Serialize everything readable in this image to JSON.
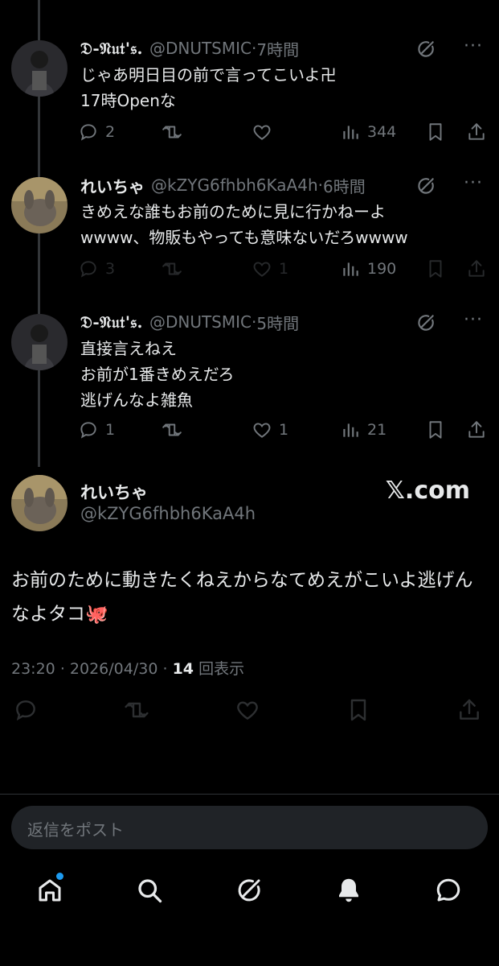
{
  "tweets": [
    {
      "name": "𝔇-𝔑𝔲𝔱'𝔰.",
      "handle": "@DNUTSMIC",
      "time": "7時間",
      "text": "じゃあ明日目の前で言ってこいよ卍\n17時Openな",
      "replies": "2",
      "retweets": "",
      "likes": "",
      "views": "344"
    },
    {
      "name": "れいちゃ",
      "handle": "@kZYG6fhbh6KaA4h",
      "time": "6時間",
      "text": "きめえな誰もお前のために見に行かねーよ\nwwww、物販もやっても意味ないだろwwww",
      "replies": "3",
      "retweets": "",
      "likes": "1",
      "views": "190"
    },
    {
      "name": "𝔇-𝔑𝔲𝔱'𝔰.",
      "handle": "@DNUTSMIC",
      "time": "5時間",
      "text": "直接言えねえ\nお前が1番きめえだろ\n逃げんなよ雑魚",
      "replies": "1",
      "retweets": "",
      "likes": "1",
      "views": "21"
    }
  ],
  "main_post": {
    "name": "れいちゃ",
    "handle": "@kZYG6fhbh6KaA4h",
    "watermark": "𝕏.com",
    "text": "お前のために動きたくねえからなてめえがこいよ逃げんなよタコ🐙",
    "time": "23:20",
    "date": "2026/04/30",
    "views_count": "14",
    "views_label": "回表示"
  },
  "reply_box": {
    "placeholder": "返信をポスト"
  },
  "nav": {
    "tabs": [
      "home-icon",
      "search-icon",
      "grok-icon",
      "notifications-icon",
      "messages-icon"
    ],
    "accent": "#1d9bf0"
  },
  "colors": {
    "background": "#000000",
    "text": "#e7e9ea",
    "muted": "#71767b"
  }
}
